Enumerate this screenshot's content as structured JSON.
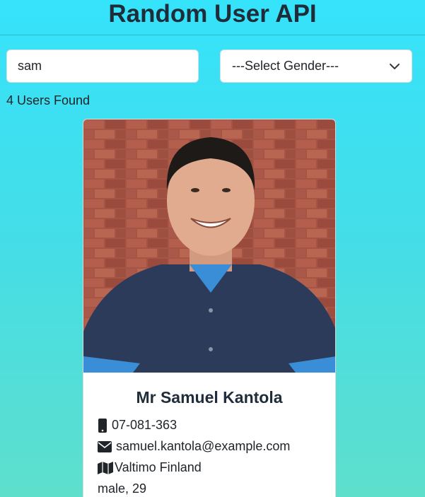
{
  "header": {
    "title": "Random User API"
  },
  "search": {
    "value": "sam"
  },
  "gender_select": {
    "selected": "---Select Gender---"
  },
  "results": {
    "count_text": "4 Users Found"
  },
  "user_card": {
    "name": "Mr Samuel Kantola",
    "phone": "07-081-363",
    "email": "samuel.kantola@example.com",
    "location": "Valtimo Finland",
    "gender_age": "male, 29",
    "icons": {
      "phone": "mobile-phone-icon",
      "email": "envelope-icon",
      "location": "map-icon"
    }
  },
  "colors": {
    "bg_top": "#35e3fb",
    "bg_bottom": "#5edfcc",
    "title": "#1f2d3a"
  }
}
